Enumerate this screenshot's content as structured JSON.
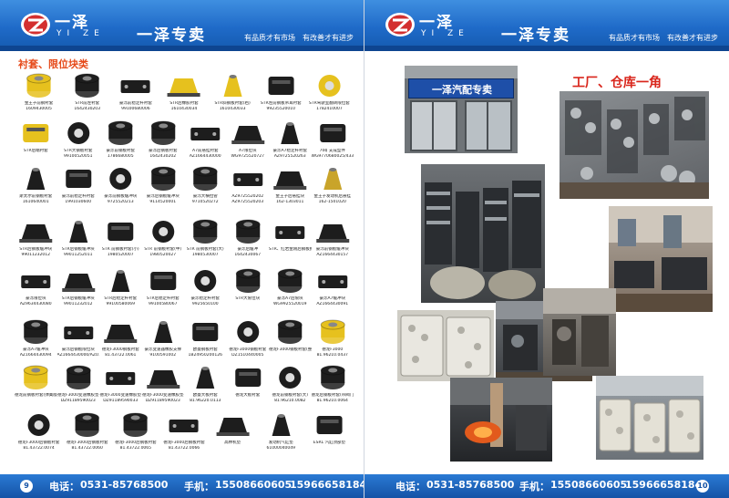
{
  "header": {
    "brand_cn": "一泽",
    "brand_en": "YI ZE",
    "shop_name": "一泽专卖",
    "motto": "有品质才有市场　有改善才有进步"
  },
  "left_page": {
    "section_title": "衬套、限位块类",
    "page_number": "9",
    "parts": [
      {
        "name": "金王子前钢衬套",
        "code": "1609430005"
      },
      {
        "name": "STR前左衬套",
        "code": "1642430203"
      },
      {
        "name": "豪泺前稳定杆衬套",
        "code": "99100680006"
      },
      {
        "name": "STR后橡胶衬套",
        "code": "1610430034"
      },
      {
        "name": "STR斜钢板衬套(右)",
        "code": "1610430033"
      },
      {
        "name": "STR左前钢板吊耳衬套",
        "code": "99235520010"
      },
      {
        "name": "STR驾驶室翻转限位套",
        "code": "1782410007"
      },
      {
        "name": "STR后端衬套",
        "code": ""
      },
      {
        "name": "STR大钢板衬套",
        "code": "99100520051"
      },
      {
        "name": "豪泺前钢板衬套",
        "code": "1786680005"
      },
      {
        "name": "豪泺后钢板衬套",
        "code": "1642430202"
      },
      {
        "name": "A7前悬挂衬套",
        "code": "AZ1664430000"
      },
      {
        "name": "A7限位块",
        "code": "WG9725520727"
      },
      {
        "name": "豪泺A7稳定杆衬套",
        "code": "AZ9725520263"
      },
      {
        "name": "70矿支成型件",
        "code": "WG9770680025/4334"
      },
      {
        "name": "斯太尔前钢板衬套",
        "code": "1610640001"
      },
      {
        "name": "豪泺前稳定杆衬套",
        "code": "1991030600"
      },
      {
        "name": "豪泺前钢板缓冲块",
        "code": "9725520213"
      },
      {
        "name": "豪泺后钢板缓冲块",
        "code": "9114520001"
      },
      {
        "name": "豪泺大横拉管",
        "code": "9710520272"
      },
      {
        "name": "AZ9725520202",
        "code": "AZ9725520203"
      },
      {
        "name": "金王子后悬挂块",
        "code": "162-1303011"
      },
      {
        "name": "金王子发动机后悬挂",
        "code": "162-1501020"
      },
      {
        "name": "STR后钢板缓冲块",
        "code": "99011232012"
      },
      {
        "name": "STR后钢板缓冲块",
        "code": "99011252011"
      },
      {
        "name": "STR 前钢板衬套(小)",
        "code": "1980520007"
      },
      {
        "name": "STR 前钢板衬套(中)",
        "code": "1980520027"
      },
      {
        "name": "STR 前钢板衬套(大)",
        "code": "1980530007"
      },
      {
        "name": "豪泺后缓冲",
        "code": "1642430067"
      },
      {
        "name": "STR、红岩金刚后钢板扣架",
        "code": ""
      },
      {
        "name": "豪泺前钢板缓冲块",
        "code": "AZ1664430157"
      },
      {
        "name": "豪泺限位块",
        "code": "AZ9634430080"
      },
      {
        "name": "STR后钢板缓冲块",
        "code": "99011232012"
      },
      {
        "name": "STR后稳定杆衬套",
        "code": "99100580069"
      },
      {
        "name": "STR后稳定杆衬套",
        "code": "99100580067"
      },
      {
        "name": "豪泺稳定杆衬套",
        "code": "9925650100"
      },
      {
        "name": "STR大限位块",
        "code": ""
      },
      {
        "name": "豪泺A7后限块",
        "code": "WG9925520019"
      },
      {
        "name": "豪泺A7缓冲块",
        "code": "AZ1664430091"
      },
      {
        "name": "豪泺A7缓冲块",
        "code": "AZ1664430094"
      },
      {
        "name": "豪泺后钢板限位块",
        "code": "AZ1664430000/AZ01"
      },
      {
        "name": "德龙F3000钢板衬套",
        "code": "81.43722.0061"
      },
      {
        "name": "豪泺变速器橡胶支撑",
        "code": "9100591002"
      },
      {
        "name": "欧曼钢板衬套",
        "code": "1B24950200126"
      },
      {
        "name": "德龙F3000钢板衬套",
        "code": "DZ1510440005"
      },
      {
        "name": "德龙F3000钢板衬套(整装版)",
        "code": ""
      },
      {
        "name": "德龙F3000",
        "code": "81.96210.0437"
      },
      {
        "name": "德龙前钢板衬套(弹簧版)",
        "code": ""
      },
      {
        "name": "德龙F3000变速橡胶垫",
        "code": "DZ91189590023"
      },
      {
        "name": "德龙F3000变速橡胶垫",
        "code": "DZ91189590033"
      },
      {
        "name": "德龙F3000变速橡胶垫",
        "code": "DZ91189590023"
      },
      {
        "name": "欧曼大板衬套",
        "code": "81.96220.0113"
      },
      {
        "name": "德龙大板衬套",
        "code": ""
      },
      {
        "name": "德龙前钢板衬套(大)",
        "code": "81.96210.0082"
      },
      {
        "name": "德龙后钢板衬套(带阀门)",
        "code": "81.96210.0064"
      },
      {
        "name": "德龙F3000后钢板衬套",
        "code": "81.43722.0074"
      },
      {
        "name": "德龙F3000后钢板衬套",
        "code": "81.43722.0060"
      },
      {
        "name": "德龙F3000后钢板衬套",
        "code": "81.43722.0065"
      },
      {
        "name": "德龙F3000后钢板衬套",
        "code": "81.43722.0066"
      },
      {
        "name": "高林机垫",
        "code": ""
      },
      {
        "name": "发动机气缸垫",
        "code": "61000040049"
      },
      {
        "name": "ESRL 汽缸顶部垫",
        "code": ""
      }
    ]
  },
  "right_page": {
    "section_title": "工厂、仓库一角",
    "page_number": "10",
    "storefront_sign": "一泽汽配专卖",
    "photos": [
      "storefront",
      "warehouse-top-right",
      "warehouse-mid-left",
      "warehouse-mid-right",
      "workshop-lower-left",
      "workshop-lower-center",
      "factory-lower-right",
      "forge-bottom-center",
      "warehouse-bottom-right"
    ]
  },
  "footer": {
    "phone_label": "电话：",
    "phone": "0531-85768500",
    "mobile_label": "手机：",
    "mobile1": "15508660605",
    "mobile2": "15966658184"
  },
  "colors": {
    "header_blue": "#1f6ac8",
    "section_orange": "#e64a1a",
    "factory_red": "#d9261c",
    "part_yellow": "#e6c11e",
    "part_black": "#1d1d1d"
  }
}
